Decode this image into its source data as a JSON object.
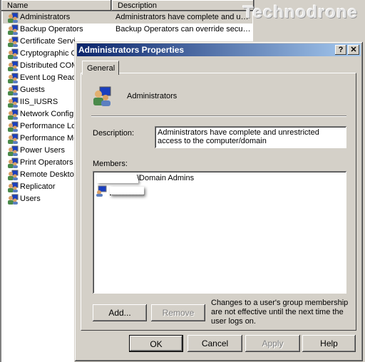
{
  "watermark": "Technodrone",
  "list": {
    "columns": [
      "Name",
      "Description"
    ],
    "rows": [
      {
        "name": "Administrators",
        "desc": "Administrators have complete and u…"
      },
      {
        "name": "Backup Operators",
        "desc": "Backup Operators can override secu…"
      },
      {
        "name": "Certificate Servi",
        "desc": ""
      },
      {
        "name": "Cryptographic O",
        "desc": ""
      },
      {
        "name": "Distributed COM",
        "desc": ""
      },
      {
        "name": "Event Log Reade",
        "desc": ""
      },
      {
        "name": "Guests",
        "desc": ""
      },
      {
        "name": "IIS_IUSRS",
        "desc": ""
      },
      {
        "name": "Network Configu",
        "desc": ""
      },
      {
        "name": "Performance Log",
        "desc": ""
      },
      {
        "name": "Performance Mo",
        "desc": ""
      },
      {
        "name": "Power Users",
        "desc": ""
      },
      {
        "name": "Print Operators",
        "desc": ""
      },
      {
        "name": "Remote Desktop",
        "desc": ""
      },
      {
        "name": "Replicator",
        "desc": ""
      },
      {
        "name": "Users",
        "desc": ""
      }
    ]
  },
  "dialog": {
    "title": "Administrators Properties",
    "help": "?",
    "close": "✕",
    "tab": "General",
    "group_name": "Administrators",
    "description_label": "Description:",
    "description": "Administrators have complete and unrestricted access to the computer/domain",
    "members_label": "Members:",
    "members": [
      "\\Domain Admins",
      ""
    ],
    "add": "Add...",
    "remove": "Remove",
    "note": "Changes to a user's group membership are not effective until the next time the user logs on.",
    "ok": "OK",
    "cancel": "Cancel",
    "apply": "Apply",
    "helpbtn": "Help"
  }
}
